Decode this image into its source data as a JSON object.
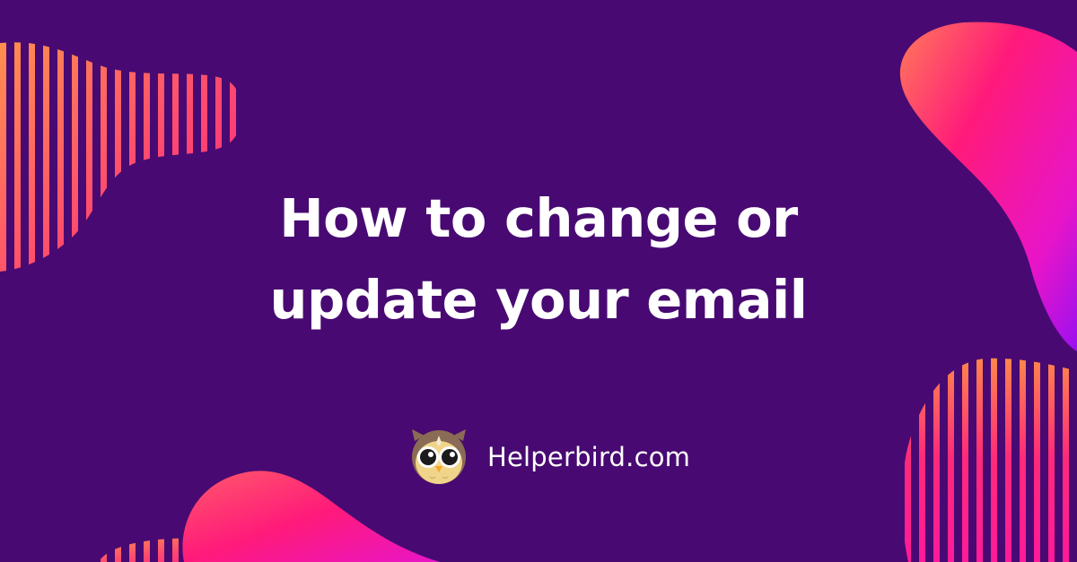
{
  "headline": {
    "line1": "How to change or",
    "line2": "update your email"
  },
  "brand": {
    "name": "Helperbird.com",
    "logo_icon": "owl-icon"
  },
  "colors": {
    "background": "#480a72",
    "text": "#ffffff",
    "accent_orange": "#ff9a4a",
    "accent_pink": "#ff1a7a",
    "accent_magenta": "#e815c8",
    "accent_violet": "#9b10f0",
    "owl_body": "#efd48a",
    "owl_head": "#8a6b55"
  }
}
